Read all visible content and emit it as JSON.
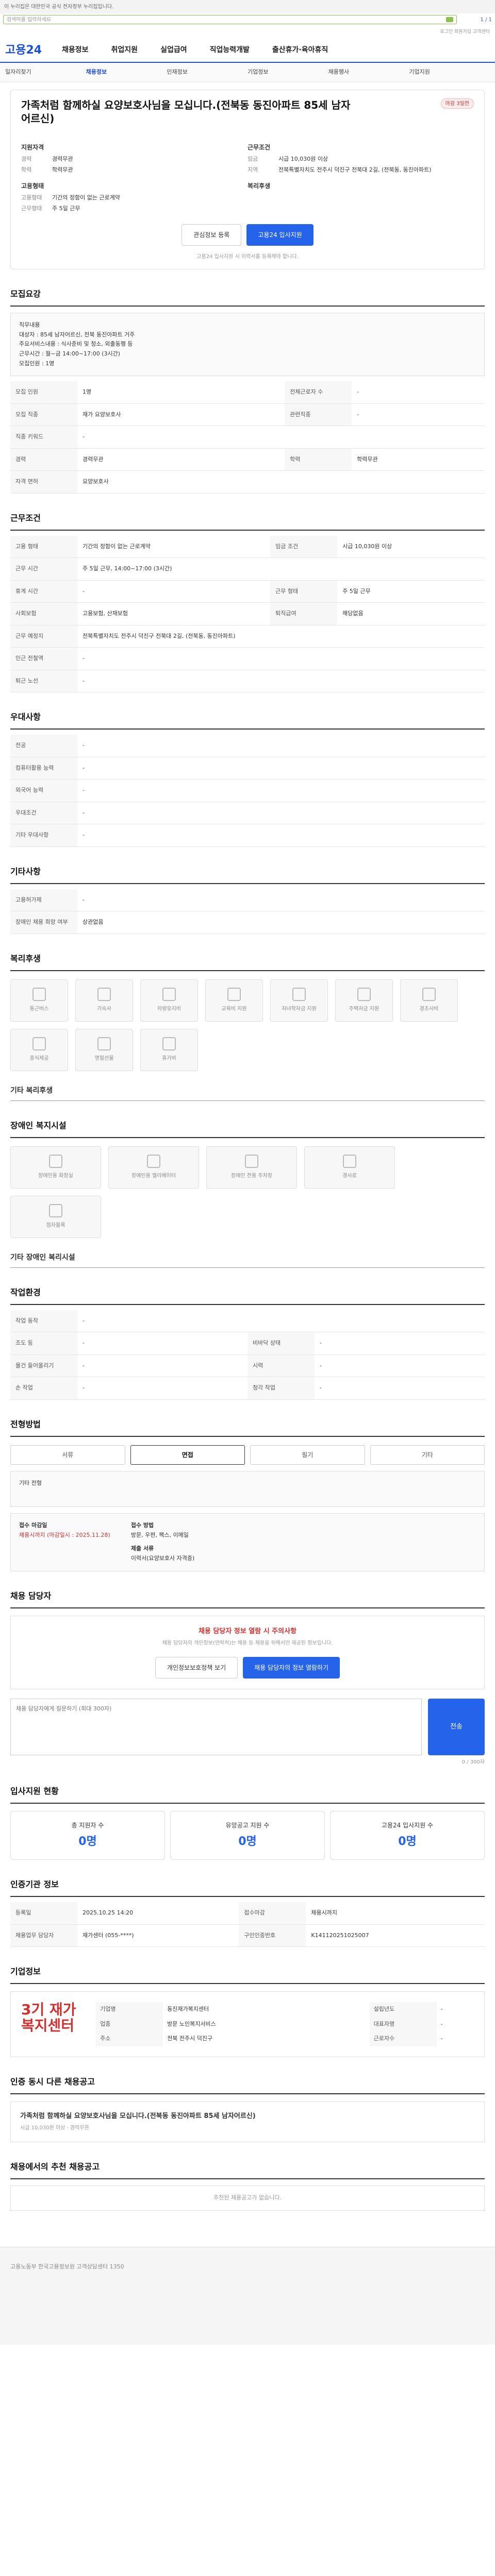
{
  "gov_banner": "이 누리집은 대한민국 공식 전자정부 누리집입니다.",
  "search": {
    "placeholder": "검색어를 입력하세요",
    "count": "1 / 1"
  },
  "utility": "로그인 회원가입 고객센터",
  "logo": "고용24",
  "gnb": [
    "채용정보",
    "취업지원",
    "실업급여",
    "직업능력개발",
    "출산휴가·육아휴직"
  ],
  "lnb": [
    "일자리찾기",
    "채용정보",
    "인재정보",
    "기업정보",
    "채용행사",
    "기업지원"
  ],
  "job": {
    "title": "가족처럼 함께하실 요양보호사님을 모십니다.(전북동 동진아파트 85세 남자어르신)",
    "badge": "마감 3일전",
    "company_label": "채용정보",
    "left_h": "지원자격",
    "rows_left": [
      [
        "경력",
        "경력무관"
      ],
      [
        "학력",
        "학력무관"
      ]
    ],
    "left_h2": "고용형태",
    "rows_left2": [
      [
        "고용형태",
        "기간의 정함이 없는 근로계약"
      ],
      [
        "근무형태",
        "주 5일 근무"
      ]
    ],
    "right_h": "근무조건",
    "rows_right": [
      [
        "임금",
        "시급 10,030원 이상"
      ],
      [
        "지역",
        "전북특별자치도 전주시 덕진구 전북대 2길, (전북동, 동진아파트)"
      ]
    ],
    "right_h2": "복리후생",
    "btn_save": "관심정보 등록",
    "btn_apply": "고용24 입사지원",
    "notice": "고용24 입사지원 시 이력서를 등록해야 합니다."
  },
  "sec_company": "모집요강",
  "company_box": "직무내용\n대상자 : 85세 남자어르신, 전북 동진아파트 거주\n주요서비스내용 : 식사준비 및 청소, 외출동행 등\n근무시간 : 월~금 14:00~17:00 (3시간)\n모집인원 : 1명",
  "recruit": [
    [
      "모집 인원",
      "1명",
      "전체근로자 수",
      "-"
    ],
    [
      "모집 직종",
      "재가 요양보호사",
      "관련직종",
      "-"
    ],
    [
      "직종 키워드",
      "-",
      "",
      ""
    ],
    [
      "경력",
      "경력무관",
      "학력",
      "학력무관"
    ],
    [
      "자격 면허",
      "요양보호사",
      "",
      ""
    ]
  ],
  "sec_cond": "근무조건",
  "cond": [
    [
      "고용 형태",
      "기간의 정함이 없는 근로계약",
      "임금 조건",
      "시급 10,030원 이상"
    ],
    [
      "근무 시간",
      "주 5일 근무, 14:00~17:00 (3시간)",
      "",
      ""
    ],
    [
      "휴게 시간",
      "-",
      "근무 형태",
      "주 5일 근무"
    ],
    [
      "사회보험",
      "고용보험, 산재보험",
      "퇴직급여",
      "해당없음"
    ],
    [
      "근무 예정지",
      "전북특별자치도 전주시 덕진구 전북대 2길, (전북동, 동진아파트)",
      "",
      ""
    ],
    [
      "인근 전철역",
      "-",
      "",
      ""
    ],
    [
      "퇴근 노선",
      "-",
      "",
      ""
    ]
  ],
  "sec_prefer": "우대사항",
  "prefer": [
    [
      "전공",
      "-"
    ],
    [
      "컴퓨터활용 능력",
      "-"
    ],
    [
      "외국어 능력",
      "-"
    ],
    [
      "우대조건",
      "-"
    ],
    [
      "기타 우대사항",
      "-"
    ]
  ],
  "sec_etc": "기타사항",
  "etc": [
    [
      "고용허가제",
      "-"
    ],
    [
      "장애인 채용 희망 여부",
      "상관없음"
    ]
  ],
  "sec_welfare": "복리후생",
  "welfare": [
    "통근버스",
    "기숙사",
    "차량유지비",
    "교육비 지원",
    "자녀학자금 지원",
    "주택자금 지원",
    "경조사비",
    "중식제공",
    "명절선물",
    "휴가비"
  ],
  "welfare_etc": "기타 복리후생",
  "sec_disabled": "장애인 복지시설",
  "disabled": [
    "장애인용 화장실",
    "장애인용 엘리베이터",
    "장애인 전용 주차장",
    "경사로",
    "점자블록"
  ],
  "disabled_etc": "기타 장애인 복리시설",
  "sec_env": "작업환경",
  "env": [
    [
      "작업 동작",
      "-",
      "",
      ""
    ],
    [
      "조도 등",
      "-",
      "비바닥 상태",
      "-"
    ],
    [
      "물건 들어올리기",
      "-",
      "시력",
      "-"
    ],
    [
      "손 작업",
      "-",
      "청각 작업",
      "-"
    ]
  ],
  "sec_method": "전형방법",
  "methods": [
    "서류",
    "면접",
    "필기",
    "기타"
  ],
  "method_etc": "기타 전형",
  "apply": {
    "period_h": "접수 마감일",
    "period": "채용시까지 (마감일시 : 2025.11.28)",
    "how_h": "접수 방법",
    "how": "방문, 우편, 팩스, 이메일",
    "doc_h": "제출 서류",
    "doc": "이력서(요양보호사 자격증)"
  },
  "sec_manager": "채용 담당자",
  "manager_alert": "채용 담당자 정보 열람 시 주의사항",
  "manager_desc": "채용 담당자의 개인정보(연락처)는 채용 등 채용을 위해서만 제공된 정보입니다.",
  "manager_btns": [
    "개인정보보호정책 보기",
    "채용 담당자의 정보 열람하기"
  ],
  "qa": {
    "placeholder": "채용 담당자에게 질문하기 (최대 300자)",
    "send": "전송",
    "count": "0 / 300자"
  },
  "sec_stats": "입사지원 현황",
  "stats": [
    [
      "총 지원자 수",
      "0명"
    ],
    [
      "유망공고 지원 수",
      "0명"
    ],
    [
      "고용24 입사지원 수",
      "0명"
    ]
  ],
  "sec_info": "인증기관 정보",
  "info": [
    [
      "등록일",
      "2025.10.25 14:20",
      "접수마감",
      "채용시까지"
    ],
    [
      "채용업무 담당자",
      "재가센터 (055-****)",
      "구인인증번호",
      "K141120251025007"
    ]
  ],
  "sec_corp": "기업정보",
  "corp": {
    "logo": "3기 재가복지센터",
    "rows": [
      [
        "기업명",
        "동진재가복지센터"
      ],
      [
        "업종",
        "방문 노인복지서비스"
      ],
      [
        "주소",
        "전북 전주시 덕진구"
      ],
      [
        "설립년도",
        "-"
      ],
      [
        "대표자명",
        "-"
      ],
      [
        "근로자수",
        "-"
      ]
    ]
  },
  "sec_other": "인증 동시 다른 채용공고",
  "other": {
    "title": "가족처럼 함께하실 요양보호사님을 모십니다.(전북동 동진아파트 85세 남자어르신)",
    "meta": "시급 10,030원 이상 · 경력무관"
  },
  "sec_recommend": "채용에서의 추천 채용공고",
  "recommend_empty": "추천된 채용공고가 없습니다.",
  "footer": "고용노동부 한국고용정보원 고객상담센터 1350"
}
